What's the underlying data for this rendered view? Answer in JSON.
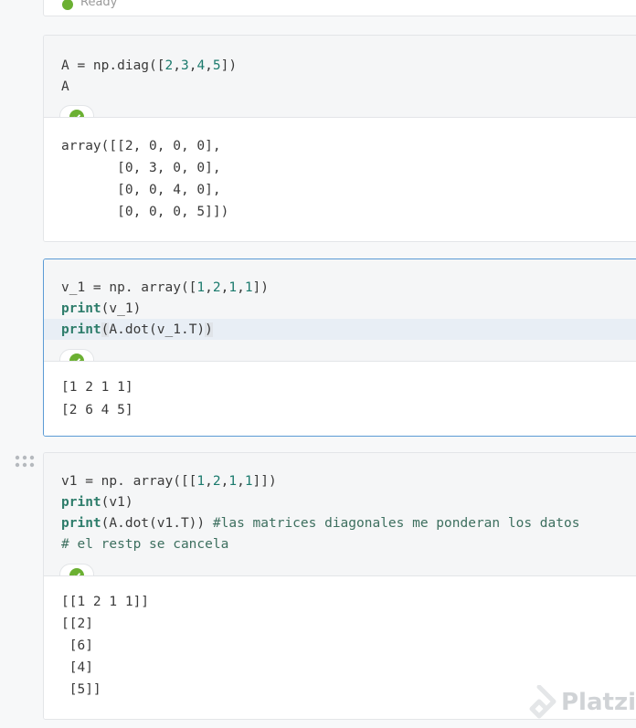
{
  "top_cell": {
    "status": "Ready"
  },
  "cell1": {
    "code": [
      "A = np.diag([2,3,4,5])",
      "A"
    ],
    "output": [
      "array([[2, 0, 0, 0],",
      "       [0, 3, 0, 0],",
      "       [0, 0, 4, 0],",
      "       [0, 0, 0, 5]])"
    ]
  },
  "cell2": {
    "code": [
      "v_1 = np. array([1,2,1,1])",
      "print(v_1)",
      "print(A.dot(v_1.T))"
    ],
    "output": [
      "[1 2 1 1]",
      "[2 6 4 5]"
    ]
  },
  "cell3": {
    "code": [
      "v1 = np. array([[1,2,1,1]])",
      "print(v1)",
      "print(A.dot(v1.T)) #las matrices diagonales me ponderan los datos",
      "# el restp se cancela"
    ],
    "output": [
      "[[1 2 1 1]]",
      "[[2]",
      " [6]",
      " [4]",
      " [5]]"
    ]
  },
  "watermark": "Platzi",
  "colors": {
    "success": "#6bb032",
    "active_border": "#5b9bd5",
    "code_bg": "#f5f6f7"
  },
  "icons": {
    "status": "check-circle-icon",
    "drag": "drag-handle-icon",
    "logo": "platzi-logo-icon"
  }
}
